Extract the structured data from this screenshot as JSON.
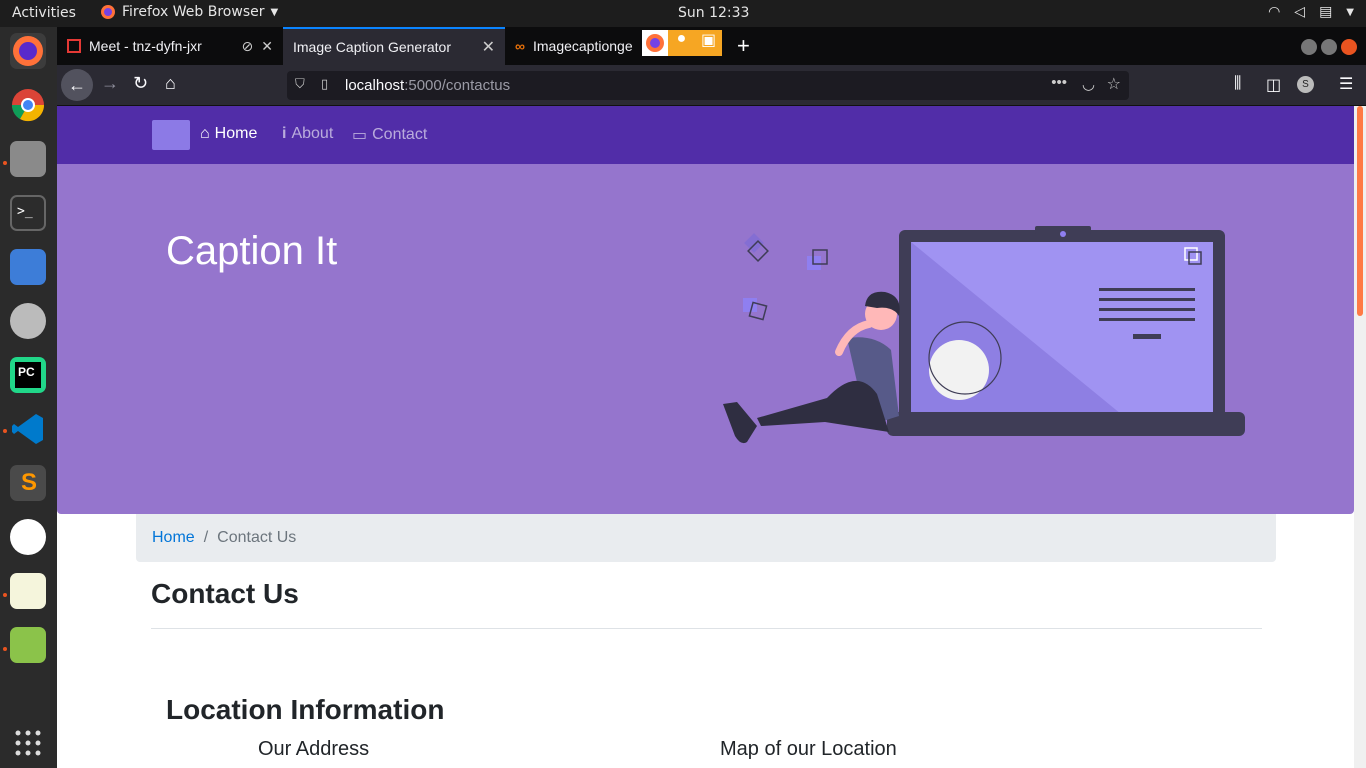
{
  "topbar": {
    "activities": "Activities",
    "app_name": "Firefox Web Browser",
    "clock": "Sun 12:33"
  },
  "dock": {
    "items": [
      "firefox-icon",
      "chrome-icon",
      "files-icon",
      "terminal-icon",
      "image-viewer-icon",
      "rhythmbox-icon",
      "pycharm-icon",
      "vscode-icon",
      "sublime-icon",
      "android-studio-icon",
      "text-editor-icon",
      "system-monitor-icon",
      "apps-grid-icon"
    ]
  },
  "browser": {
    "tabs": [
      {
        "label": "Meet - tnz-dyfn-jxr",
        "active": false
      },
      {
        "label": "Image Caption Generator",
        "active": true
      },
      {
        "label": "Imagecaptionge",
        "active": false
      }
    ],
    "new_tab": "+",
    "url_host": "localhost",
    "url_rest": ":5000/contactus",
    "profile_initial": "S"
  },
  "site": {
    "nav": {
      "home": "Home",
      "about": "About",
      "contact": "Contact"
    },
    "hero_title": "Caption It",
    "breadcrumb": {
      "home": "Home",
      "separator": "/",
      "current": "Contact Us"
    },
    "contact_title": "Contact Us",
    "location_title": "Location Information",
    "address_heading": "Our Address",
    "map_heading": "Map of our Location"
  },
  "colors": {
    "nav_bg": "#512da8",
    "hero_bg": "#9575cd",
    "link": "#0275d8",
    "accent": "#0a84ff"
  }
}
